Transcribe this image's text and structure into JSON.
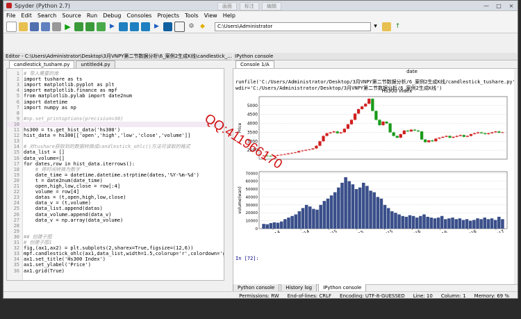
{
  "window": {
    "title": "Spyder (Python 2.7)",
    "overlay_buttons": [
      "画面",
      "标注",
      "编辑"
    ],
    "controls": [
      "—",
      "□",
      "×"
    ]
  },
  "menu": [
    "File",
    "Edit",
    "Search",
    "Source",
    "Run",
    "Debug",
    "Consoles",
    "Projects",
    "Tools",
    "View",
    "Help"
  ],
  "toolbar": {
    "path": "C:\\Users\\Administrator"
  },
  "editor": {
    "header": "Editor - C:\\Users\\Administrator\\Desktop\\3月VNPY第二节数据分析\\6_案例2生成K线\\candlestick_…",
    "tabs": [
      "candlestick_tushare.py",
      "untitled4.py"
    ],
    "lines": [
      {
        "n": "1",
        "t": "# 导入需要的库",
        "c": "cm"
      },
      {
        "n": "2",
        "t": "import tushare as ts",
        "c": ""
      },
      {
        "n": "3",
        "t": "import matplotlib.pyplot as plt",
        "c": ""
      },
      {
        "n": "4",
        "t": "import matplotlib.finance as mpf",
        "c": ""
      },
      {
        "n": "5",
        "t": "from matplotlib.pylab import date2num",
        "c": ""
      },
      {
        "n": "6",
        "t": "import datetime",
        "c": ""
      },
      {
        "n": "7",
        "t": "import numpy as np",
        "c": ""
      },
      {
        "n": "8",
        "t": "",
        "c": ""
      },
      {
        "n": "9",
        "t": "#np.set_printoptions(precision=30)",
        "c": "cm"
      },
      {
        "n": "10",
        "t": "",
        "c": "hl"
      },
      {
        "n": "11",
        "t": "hs300 = ts.get_hist_data('hs300')",
        "c": ""
      },
      {
        "n": "12",
        "t": "hist_data = hs300[['open','high','low','close','volume']]",
        "c": ""
      },
      {
        "n": "13",
        "t": "",
        "c": ""
      },
      {
        "n": "14",
        "t": "# 对tushare获取到的数据转换成candlestick_ohlc()方法可读取的格式",
        "c": "cm"
      },
      {
        "n": "15",
        "t": "data_list = []",
        "c": ""
      },
      {
        "n": "16",
        "t": "data_volume=[]",
        "c": ""
      },
      {
        "n": "17",
        "t": "for dates,row in hist_data.iterrows():",
        "c": ""
      },
      {
        "n": "18",
        "t": "    # 将时间转换为数字",
        "c": "cm"
      },
      {
        "n": "19",
        "t": "    date_time = datetime.datetime.strptime(dates,'%Y-%m-%d')",
        "c": ""
      },
      {
        "n": "20",
        "t": "    t = date2num(date_time)",
        "c": ""
      },
      {
        "n": "21",
        "t": "    open,high,low,close = row[:4]",
        "c": ""
      },
      {
        "n": "22",
        "t": "    volume = row[4]",
        "c": ""
      },
      {
        "n": "23",
        "t": "    datas = (t,open,high,low,close)",
        "c": ""
      },
      {
        "n": "24",
        "t": "    data_v = (t,volume)",
        "c": ""
      },
      {
        "n": "25",
        "t": "    data_list.append(datas)",
        "c": ""
      },
      {
        "n": "26",
        "t": "    data_volume.append(data_v)",
        "c": ""
      },
      {
        "n": "27",
        "t": "    data_v = np.array(data_volume)",
        "c": ""
      },
      {
        "n": "28",
        "t": "",
        "c": ""
      },
      {
        "n": "29",
        "t": "",
        "c": ""
      },
      {
        "n": "30",
        "t": "## 创建子图",
        "c": "cm"
      },
      {
        "n": "31",
        "t": "# 创建子图1",
        "c": "cm"
      },
      {
        "n": "32",
        "t": "fig,(ax1,ax2) = plt.subplots(2,sharex=True,figsize=(12,6))",
        "c": ""
      },
      {
        "n": "33",
        "t": "mpf.candlestick_ohlc(ax1,data_list,width=1.5,colorup='r',colordown='green')",
        "c": ""
      },
      {
        "n": "34",
        "t": "ax1.set_title('Hs300 Index')",
        "c": ""
      },
      {
        "n": "35",
        "t": "ax1.set_ylabel('Price')",
        "c": ""
      },
      {
        "n": "36",
        "t": "ax1.grid(True)",
        "c": ""
      }
    ]
  },
  "watermark": "QQ:411966170",
  "console": {
    "header": "IPython console",
    "tab": "Console 1/A",
    "run_line1": "runfile('C:/Users/Administrator/Desktop/3月VNPY第二节数据分析/6_案例2生成K线/candlestick_tushare.py',",
    "run_line2": "wdir='C:/Users/Administrator/Desktop/3月VNPY第二节数据分析/6_案例2生成K线')",
    "prompt": "In [72]:"
  },
  "chart_data": {
    "type": "candlestick",
    "title": "Hs300 Index",
    "top_label": "date",
    "ylabel_top": "Price",
    "ylabel_bottom": "volume(wan)",
    "price_ticks": [
      2500,
      3000,
      3500,
      4000,
      4500,
      5000
    ],
    "volume_ticks": [
      0,
      10000,
      20000,
      30000,
      40000,
      50000,
      60000,
      70000
    ],
    "x_ticks": [
      "Jul 2014",
      "Nov 2014",
      "Mar 2015",
      "Jul 2015",
      "Nov 2015",
      "Mar 2016",
      "Jul 2016",
      "Nov 2016",
      "Mar 2017"
    ],
    "price_series": [
      2200,
      2180,
      2160,
      2200,
      2230,
      2250,
      2280,
      2320,
      2350,
      2380,
      2450,
      2480,
      2520,
      2550,
      2600,
      2750,
      3000,
      3300,
      3450,
      3500,
      3550,
      3450,
      3500,
      3700,
      3950,
      4200,
      4550,
      4800,
      4950,
      5100,
      5380,
      4700,
      4200,
      3900,
      4100,
      4000,
      3500,
      3300,
      3200,
      3400,
      3600,
      3550,
      3650,
      3600,
      3550,
      3100,
      2950,
      3050,
      3000,
      3150,
      3200,
      3250,
      3300,
      3200,
      3250,
      3300,
      3350,
      3250,
      3300,
      3400,
      3450,
      3500,
      3450,
      3400,
      3450,
      3500,
      3550,
      3480,
      3500
    ],
    "volume_series": [
      6000,
      5500,
      7000,
      8000,
      7500,
      9000,
      12000,
      14000,
      16000,
      18000,
      22000,
      26000,
      30000,
      28000,
      25000,
      24000,
      30000,
      35000,
      38000,
      42000,
      46000,
      52000,
      58000,
      65000,
      60000,
      56000,
      50000,
      52000,
      58000,
      54000,
      48000,
      46000,
      40000,
      38000,
      30000,
      26000,
      22000,
      20000,
      18000,
      16000,
      15000,
      17000,
      16000,
      14000,
      16000,
      18000,
      15000,
      14000,
      13000,
      14000,
      16000,
      12000,
      13000,
      14000,
      12000,
      13000,
      11000,
      12000,
      10000,
      11000,
      13000,
      12000,
      14000,
      12000,
      13000,
      11000,
      15000,
      12000
    ]
  },
  "bottom_tabs": [
    "Python console",
    "History log",
    "IPython console"
  ],
  "status": {
    "permissions": "Permissions: RW",
    "eol": "End-of-lines: CRLF",
    "encoding": "Encoding: UTF-8-GUESSED",
    "line": "Line: 10",
    "column": "Column: 1",
    "memory": "Memory: 69 %"
  }
}
